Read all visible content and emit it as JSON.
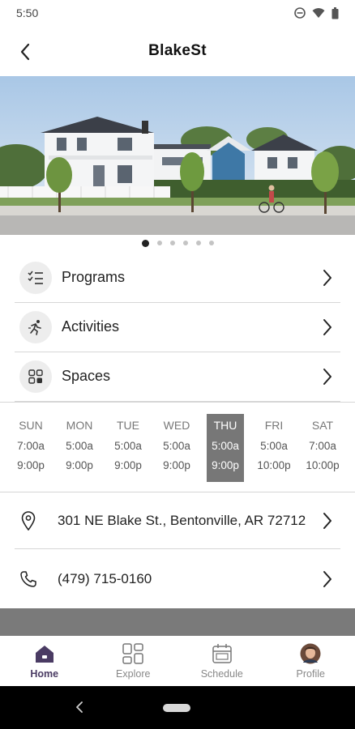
{
  "status_bar": {
    "time": "5:50"
  },
  "header": {
    "title": "BlakeSt"
  },
  "carousel": {
    "page_count": 6,
    "active_index": 0
  },
  "menu": {
    "items": [
      {
        "label": "Programs",
        "icon": "checklist-icon"
      },
      {
        "label": "Activities",
        "icon": "running-person-icon"
      },
      {
        "label": "Spaces",
        "icon": "grid-squares-icon"
      }
    ]
  },
  "hours": {
    "days": [
      {
        "name": "SUN",
        "open": "7:00a",
        "close": "9:00p"
      },
      {
        "name": "MON",
        "open": "5:00a",
        "close": "9:00p"
      },
      {
        "name": "TUE",
        "open": "5:00a",
        "close": "9:00p"
      },
      {
        "name": "WED",
        "open": "5:00a",
        "close": "9:00p"
      },
      {
        "name": "THU",
        "open": "5:00a",
        "close": "9:00p"
      },
      {
        "name": "FRI",
        "open": "5:00a",
        "close": "10:00p"
      },
      {
        "name": "SAT",
        "open": "7:00a",
        "close": "10:00p"
      }
    ],
    "highlighted_day": "THU"
  },
  "contact": {
    "address": "301 NE Blake St., Bentonville, AR 72712",
    "phone": "(479) 715-0160"
  },
  "bottom_nav": {
    "tabs": [
      {
        "label": "Home",
        "icon": "home-icon"
      },
      {
        "label": "Explore",
        "icon": "explore-grid-icon"
      },
      {
        "label": "Schedule",
        "icon": "calendar-icon"
      },
      {
        "label": "Profile",
        "icon": "avatar"
      }
    ],
    "active_tab": "Home"
  },
  "colors": {
    "accent": "#4a3b63",
    "highlight": "#777777",
    "band": "#7a7a7a"
  }
}
